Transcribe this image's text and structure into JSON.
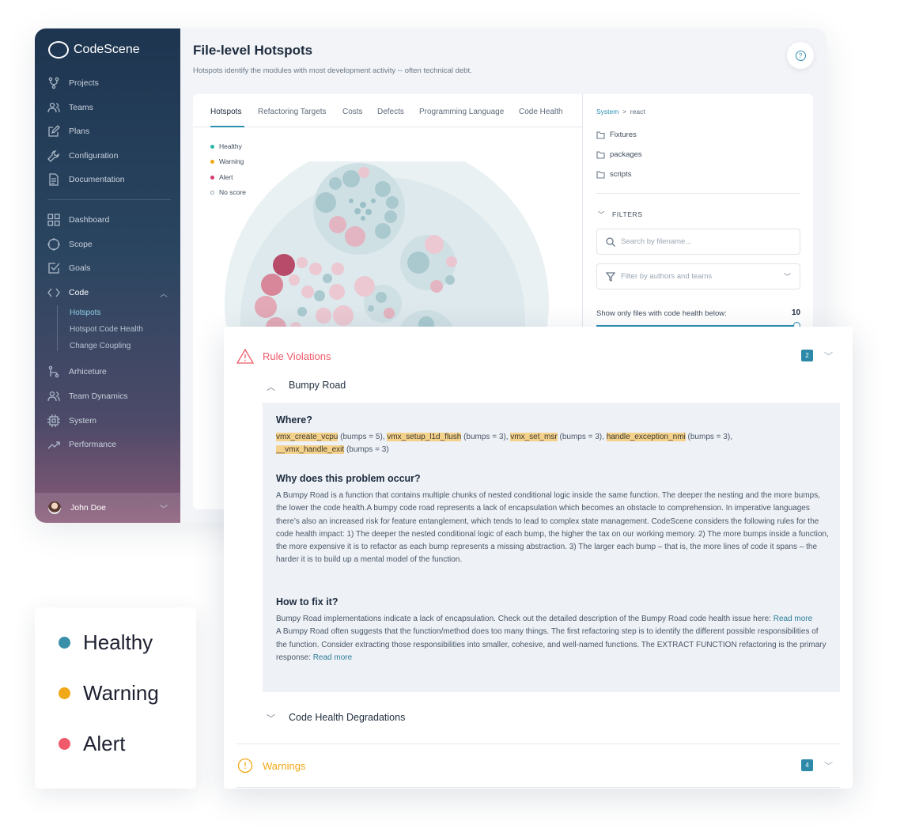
{
  "colors": {
    "accent": "#2d8fb0",
    "healthy": "#3a8fa8",
    "warning": "#f0a818",
    "alert": "#f05a6a",
    "highlight": "#f5d28c"
  },
  "app": {
    "name": "CodeScene"
  },
  "sidebar": {
    "items": [
      {
        "label": "Projects",
        "icon": "git-icon"
      },
      {
        "label": "Teams",
        "icon": "people-icon"
      },
      {
        "label": "Plans",
        "icon": "edit-icon"
      },
      {
        "label": "Configuration",
        "icon": "wrench-icon"
      },
      {
        "label": "Documentation",
        "icon": "document-icon"
      },
      {
        "label": "Dashboard",
        "icon": "grid-icon"
      },
      {
        "label": "Scope",
        "icon": "target-icon"
      },
      {
        "label": "Goals",
        "icon": "checkbox-icon"
      },
      {
        "label": "Code",
        "icon": "code-icon"
      },
      {
        "label": "Arhiceture",
        "icon": "branch-icon"
      },
      {
        "label": "Team Dynamics",
        "icon": "people-icon"
      },
      {
        "label": "System",
        "icon": "chip-icon"
      },
      {
        "label": "Performance",
        "icon": "trend-icon"
      }
    ],
    "code_sub": [
      "Hotspots",
      "Hotspot Code Health",
      "Change Coupling"
    ],
    "user": "John Doe"
  },
  "page": {
    "title": "File-level Hotspots",
    "subtitle": "Hotspots identify the modules with most development activity -- often technical debt.",
    "help_icon": "?"
  },
  "tabs": [
    "Hotspots",
    "Refactoring Targets",
    "Costs",
    "Defects",
    "Programming Language",
    "Code Health"
  ],
  "small_legend": [
    "Healthy",
    "Warning",
    "Alert",
    "No score"
  ],
  "breadcrumb": {
    "root": "System",
    "sep": ">",
    "current": "react"
  },
  "folders": [
    "Fixtures",
    "packages",
    "scripts"
  ],
  "filters": {
    "title": "FILTERS",
    "search_placeholder": "Search by filename...",
    "authors_placeholder": "Filter by authors and teams",
    "slider_label": "Show only files with code health below:",
    "slider_value": "10"
  },
  "panel": {
    "rule_violations": {
      "title": "Rule Violations",
      "count": "2"
    },
    "bumpy_road": "Bumpy Road",
    "where_title": "Where?",
    "functions": [
      {
        "name": "vmx_create_vcpu",
        "bumps": " (bumps = 5), "
      },
      {
        "name": "vmx_setup_l1d_flush",
        "bumps": " (bumps = 3), "
      },
      {
        "name": "vmx_set_msr",
        "bumps": " (bumps = 3), "
      },
      {
        "name": "handle_exception_nmi",
        "bumps": " (bumps = 3),"
      },
      {
        "name": "__vmx_handle_exit",
        "bumps": " (bumps = 3)"
      }
    ],
    "why_title": "Why does this problem occur?",
    "why_text": "A Bumpy Road is a function that contains multiple chunks of nested conditional logic inside the same function. The deeper the nesting and the more bumps, the lower the code health.A bumpy code road represents a lack of encapsulation which becomes an obstacle to comprehension. In imperative languages there’s also an increased risk for feature entanglement, which tends to lead to complex state management. CodeScene considers the following rules for the code health impact: 1) The deeper the nested conditional logic of each bump, the higher the tax on our working memory. 2) The more bumps inside a function, the more expensive it is to refactor as each bump represents a missing abstraction. 3) The larger each bump – that is, the more lines of code it spans – the harder it is to build up a mental model of the function.",
    "fix_title": "How to fix it?",
    "fix_text_1": "Bumpy Road implementations indicate a lack of encapsulation. Check out the detailed description of the Bumpy Road code health issue here: ",
    "fix_link_1": "Read more",
    "fix_text_2": "A Bumpy Road often suggests that the function/method does too many things. The first refactoring step is to identify the different possible responsibilities of the function. Consider extracting those responsibilities into smaller, cohesive, and well-named functions. The EXTRACT FUNCTION refactoring is the primary response: ",
    "fix_link_2": "Read more",
    "degradations": "Code Health Degradations",
    "warnings": {
      "title": "Warnings",
      "count": "4"
    }
  },
  "big_legend": [
    {
      "label": "Healthy",
      "color": "#3a8fa8"
    },
    {
      "label": "Warning",
      "color": "#f0a818"
    },
    {
      "label": "Alert",
      "color": "#f05a6a"
    }
  ]
}
